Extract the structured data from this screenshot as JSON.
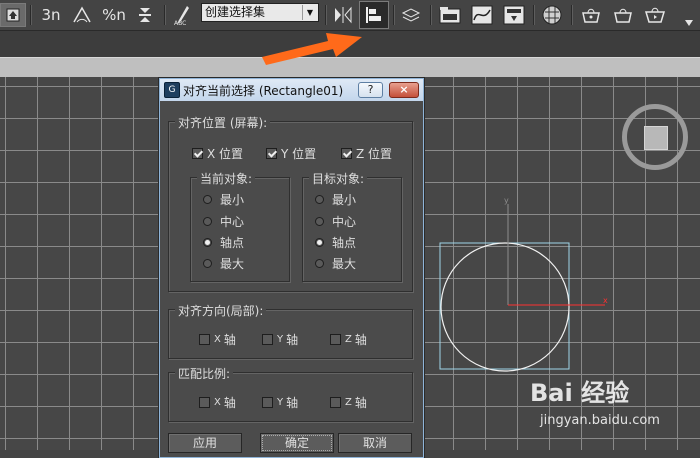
{
  "toolbar": {
    "items_before": [
      "3n",
      "%n"
    ],
    "selection_set": "创建选择集",
    "selection_set_arrow": "▼"
  },
  "dialog": {
    "app_icon_label": "G",
    "title": "对齐当前选择 (Rectangle01)",
    "help_label": "?",
    "close_label": "×",
    "align_position": {
      "title": "对齐位置 (屏幕):",
      "x": {
        "label": "X 位置",
        "checked": true
      },
      "y": {
        "label": "Y 位置",
        "checked": true
      },
      "z": {
        "label": "Z 位置",
        "checked": true
      },
      "current_object": {
        "title": "当前对象:",
        "options": [
          "最小",
          "中心",
          "轴点",
          "最大"
        ],
        "selected": "轴点"
      },
      "target_object": {
        "title": "目标对象:",
        "options": [
          "最小",
          "中心",
          "轴点",
          "最大"
        ],
        "selected": "轴点"
      }
    },
    "align_orientation": {
      "title": "对齐方向(局部):",
      "x_prefix": "X",
      "x_label": "轴",
      "y_prefix": "Y",
      "y_label": "轴",
      "z_prefix": "Z",
      "z_label": "轴"
    },
    "match_scale": {
      "title": "匹配比例:",
      "x_prefix": "X",
      "x_label": "轴",
      "y_prefix": "Y",
      "y_label": "轴",
      "z_prefix": "Z",
      "z_label": "轴"
    },
    "buttons": {
      "apply": "应用",
      "ok": "确定",
      "cancel": "取消"
    }
  },
  "viewport": {
    "axis_x": "x",
    "axis_y": "y"
  },
  "watermark": {
    "text": "Bai 经验",
    "sub": "jingyan.baidu.com"
  },
  "colors": {
    "arrow": "#ff6a1a",
    "shape_stroke": "#f2f2f2",
    "rect_stroke": "#9fd6e8",
    "axis_red": "#ff3030"
  }
}
